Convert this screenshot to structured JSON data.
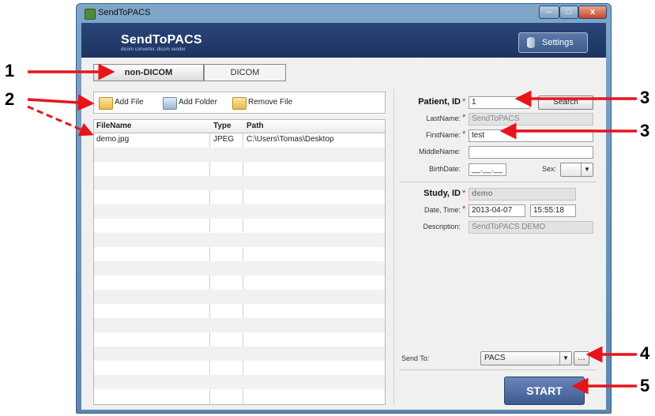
{
  "window": {
    "title": "SendToPACS",
    "controls": {
      "minimize": "–",
      "maximize": "□",
      "close": "x"
    }
  },
  "header": {
    "brand": "SendToPACS",
    "tagline": "dicom converter, dicom sender",
    "settings_label": "Settings"
  },
  "tabs": [
    {
      "label": "non-DICOM",
      "active": true
    },
    {
      "label": "DICOM",
      "active": false
    }
  ],
  "toolbar": {
    "add_file": "Add File",
    "add_folder": "Add Folder",
    "remove_file": "Remove File"
  },
  "file_table": {
    "columns": [
      "FileName",
      "Type",
      "Path"
    ],
    "rows": [
      {
        "filename": "demo.jpg",
        "type": "JPEG",
        "path": "C:\\Users\\Tomas\\Desktop"
      }
    ]
  },
  "patient": {
    "id_label": "Patient, ID",
    "id_value": "1",
    "search_label": "Search",
    "last_name_label": "LastName:",
    "last_name_value": "SendToPACS",
    "first_name_label": "FirstName:",
    "first_name_value": "test",
    "middle_name_label": "MiddleName:",
    "middle_name_value": "",
    "birth_date_label": "BirthDate:",
    "birth_date_value": "__.__.__",
    "sex_label": "Sex:",
    "sex_value": ""
  },
  "study": {
    "id_label": "Study, ID",
    "id_value": "demo",
    "datetime_label": "Date, Time:",
    "date_value": "2013-04-07",
    "time_value": "15:55:18",
    "description_label": "Description:",
    "description_value": "SendToPACS DEMO"
  },
  "send": {
    "label": "Send To:",
    "destination": "PACS",
    "start_label": "START"
  },
  "annotations": [
    "1",
    "2",
    "3",
    "3",
    "4",
    "5"
  ],
  "colors": {
    "annotation_arrow": "#e8141c",
    "header_bg": "#1d3461",
    "start_button": "#3e5b92"
  }
}
